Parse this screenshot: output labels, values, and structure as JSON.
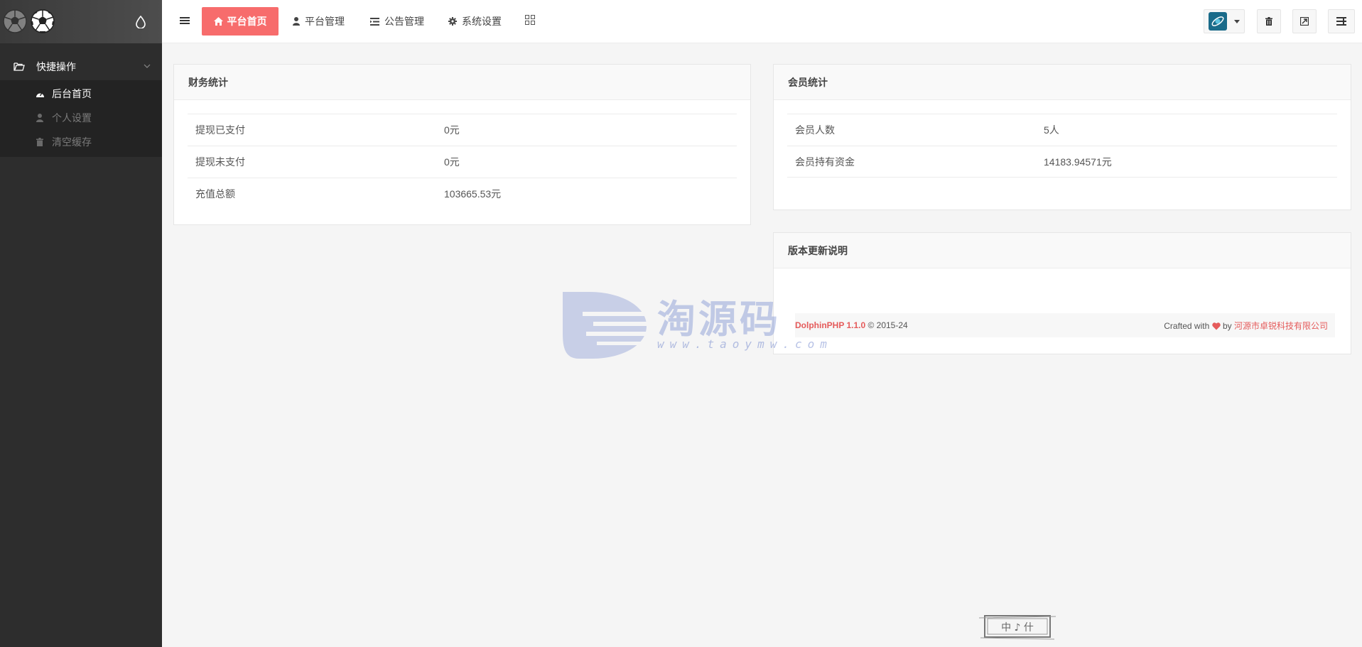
{
  "sidebar": {
    "group_label": "快捷操作",
    "items": [
      {
        "label": "后台首页",
        "icon": "dashboard-icon",
        "active": true
      },
      {
        "label": "个人设置",
        "icon": "user-icon",
        "active": false
      },
      {
        "label": "清空缓存",
        "icon": "trash-icon",
        "active": false
      }
    ]
  },
  "topbar": {
    "home_label": "平台首页",
    "nav": [
      {
        "label": "平台管理",
        "icon": "user-icon"
      },
      {
        "label": "公告管理",
        "icon": "list-icon"
      },
      {
        "label": "系统设置",
        "icon": "gear-icon"
      }
    ]
  },
  "finance": {
    "title": "财务统计",
    "rows": [
      {
        "label": "提现已支付",
        "value": "0元"
      },
      {
        "label": "提现未支付",
        "value": "0元"
      },
      {
        "label": "充值总额",
        "value": "103665.53元"
      }
    ]
  },
  "members": {
    "title": "会员统计",
    "rows": [
      {
        "label": "会员人数",
        "value": "5人"
      },
      {
        "label": "会员持有资金",
        "value": "14183.94571元"
      }
    ]
  },
  "version": {
    "title": "版本更新说明",
    "brand": "DolphinPHP 1.1.0",
    "copyright": "© 2015-24",
    "crafted": "Crafted with",
    "by": "by",
    "company": "河源市卓锐科技有限公司"
  },
  "watermark": {
    "text": "淘源码",
    "url": "www.taoymw.com"
  },
  "stamp": {
    "text": "中 ♪ 什"
  },
  "colors": {
    "accent": "#f76c6c",
    "sidebar": "#2d2d2d",
    "link_red": "#e55b5b"
  }
}
